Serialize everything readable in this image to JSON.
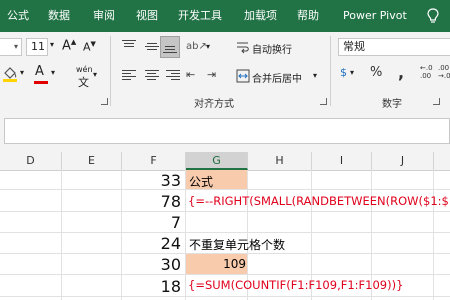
{
  "tabs": [
    "公式",
    "数据",
    "审阅",
    "视图",
    "开发工具",
    "加载项",
    "帮助",
    "Power Pivot"
  ],
  "font_size": {
    "value": "11",
    "increase_label": "A",
    "decrease_label": "A"
  },
  "font_color_label": "A",
  "pinyin_label": "wén",
  "wrap_text_label": "自动换行",
  "merge_center_label": "合并后居中",
  "number_format": "常规",
  "currency_symbol": "$",
  "percent_symbol": "%",
  "comma_symbol": ",",
  "decimals": {
    "increase": "←.0\n.00",
    "decrease": ".00\n→.0"
  },
  "groups": {
    "alignment": "对齐方式",
    "number": "数字"
  },
  "columns": [
    "D",
    "E",
    "F",
    "G",
    "H",
    "I",
    "J"
  ],
  "selected_column": "G",
  "rows": [
    {
      "f": "33",
      "g": "公式"
    },
    {
      "f": "78",
      "g": "{=--RIGHT(SMALL(RANDBETWEEN(ROW($1:$"
    },
    {
      "f": "7",
      "g": ""
    },
    {
      "f": "24",
      "g": "不重复单元格个数"
    },
    {
      "f": "30",
      "g": "109"
    },
    {
      "f": "18",
      "g": "{=SUM(COUNTIF(F1:F109,F1:F109))}"
    }
  ],
  "colors": {
    "brand": "#217346",
    "highlight": "#f8cbad",
    "formula_red": "#e0001b"
  }
}
